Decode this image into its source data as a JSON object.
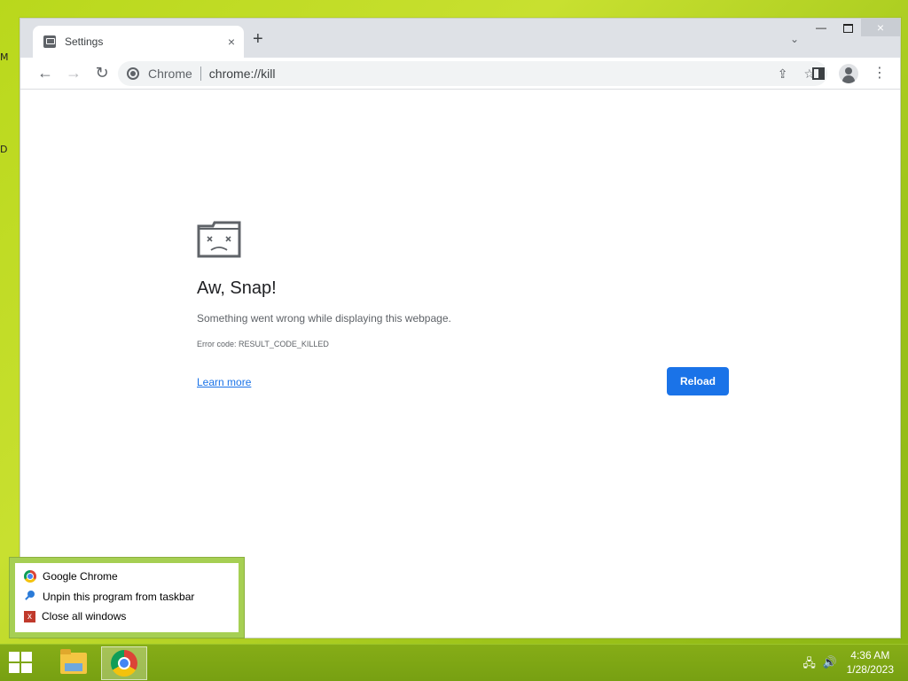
{
  "desktop": {
    "left_glyphs": [
      "M",
      "D"
    ]
  },
  "window": {
    "tab": {
      "title": "Settings",
      "close": "×"
    },
    "new_tab": "+",
    "tab_search": "⌄",
    "controls": {
      "minimize": "—",
      "maximize": "",
      "close": "×"
    }
  },
  "toolbar": {
    "back": "←",
    "forward": "→",
    "reload": "↻",
    "omnibox": {
      "chip": "Chrome",
      "url": "chrome://kill"
    },
    "share": "⇪",
    "bookmark": "☆",
    "menu": "⋮"
  },
  "page": {
    "title": "Aw, Snap!",
    "message": "Something went wrong while displaying this webpage.",
    "error_code": "Error code: RESULT_CODE_KILLED",
    "learn_more": "Learn more",
    "reload_button": "Reload"
  },
  "jumplist": {
    "items": [
      {
        "label": "Google Chrome",
        "icon": "chrome-icon"
      },
      {
        "label": "Unpin this program from taskbar",
        "icon": "unpin-icon"
      },
      {
        "label": "Close all windows",
        "icon": "close-all-icon"
      }
    ]
  },
  "taskbar": {
    "clock_time": "4:36 AM",
    "clock_date": "1/28/2023",
    "tray": [
      "network-icon",
      "volume-icon"
    ]
  },
  "colors": {
    "accent": "#1a73e8",
    "desktop": "#b9d81c",
    "taskbar": "#7ca513"
  }
}
